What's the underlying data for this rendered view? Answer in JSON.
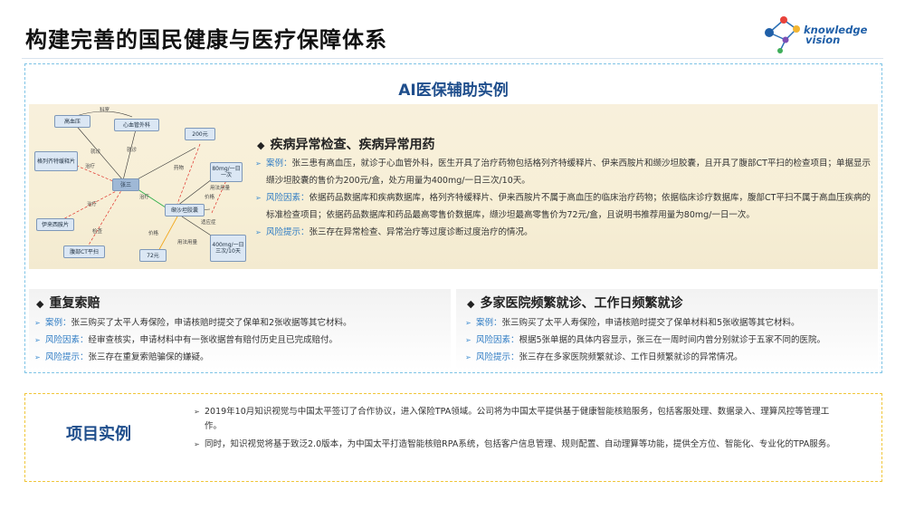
{
  "page": {
    "title": "构建完善的国民健康与医疗保障体系"
  },
  "logo": {
    "line1": "knowledge",
    "line2": "vision",
    "icon": "molecule-icon"
  },
  "ai_section": {
    "title": "AI医保辅助实例",
    "diagram": {
      "nodes": [
        "高血压",
        "心血管外科",
        "200元",
        "格列齐特缓释片",
        "张三",
        "80mg/一日一次",
        "伊来西胺片",
        "缬沙坦胶囊",
        "腹部CT平扫",
        "72元",
        "400mg/一日三次/10天"
      ],
      "edge_labels": [
        "科室",
        "就诊",
        "治疗",
        "就诊",
        "治疗",
        "检查",
        "治疗",
        "药物",
        "价格",
        "用法用量",
        "用法用量",
        "价格",
        "适应症",
        "用法用量"
      ]
    },
    "section1": {
      "heading": "疾病异常检查、疾病异常用药",
      "bullets": [
        {
          "key": "案例：",
          "text": "张三患有高血压，就诊于心血管外科，医生开具了治疗药物包括格列齐特缓释片、伊来西胺片和缬沙坦胶囊，且开具了腹部CT平扫的检查项目；单据显示缬沙坦胶囊的售价为200元/盒，处方用量为400mg/一日三次/10天。"
        },
        {
          "key": "风险因素：",
          "text": "依据药品数据库和疾病数据库，格列齐特缓释片、伊来西胺片不属于高血压的临床治疗药物；依据临床诊疗数据库，腹部CT平扫不属于高血压疾病的标准检查项目；依据药品数据库和药品最高零售价数据库，缬沙坦最高零售价为72元/盒，且说明书推荐用量为80mg/一日一次。"
        },
        {
          "key": "风险提示：",
          "text": "张三存在异常检查、异常治疗等过度诊断过度治疗的情况。"
        }
      ]
    },
    "section2": {
      "heading": "重复索赔",
      "bullets": [
        {
          "key": "案例：",
          "text": "张三购买了太平人寿保险，申请核赔时提交了保单和2张收据等其它材料。"
        },
        {
          "key": "风险因素：",
          "text": "经审查核实，申请材料中有一张收据曾有赔付历史且已完成赔付。"
        },
        {
          "key": "风险提示：",
          "text": "张三存在重复索赔骗保的嫌疑。"
        }
      ]
    },
    "section3": {
      "heading": "多家医院频繁就诊、工作日频繁就诊",
      "bullets": [
        {
          "key": "案例：",
          "text": "张三购买了太平人寿保险，申请核赔时提交了保单材料和5张收据等其它材料。"
        },
        {
          "key": "风险因素：",
          "text": "根据5张单据的具体内容显示，张三在一周时间内曾分别就诊于五家不同的医院。"
        },
        {
          "key": "风险提示：",
          "text": "张三存在多家医院频繁就诊、工作日频繁就诊的异常情况。"
        }
      ]
    }
  },
  "project": {
    "title": "项目实例",
    "items": [
      "2019年10月知识视觉与中国太平签订了合作协议，进入保险TPA领域。公司将为中国太平提供基于健康智能核赔服务，包括客服处理、数据录入、理算风控等管理工作。",
      "同时，知识视觉将基于致泛2.0版本，为中国太平打造智能核赔RPA系统，包括客户信息管理、规则配置、自动理算等功能，提供全方位、智能化、专业化的TPA服务。"
    ]
  },
  "colors": {
    "title_blue": "#1f4e8c",
    "key_blue": "#2f7cc4",
    "ai_border": "#7fc4e6",
    "project_border": "#f0c63a",
    "band": "#f7efd6"
  }
}
